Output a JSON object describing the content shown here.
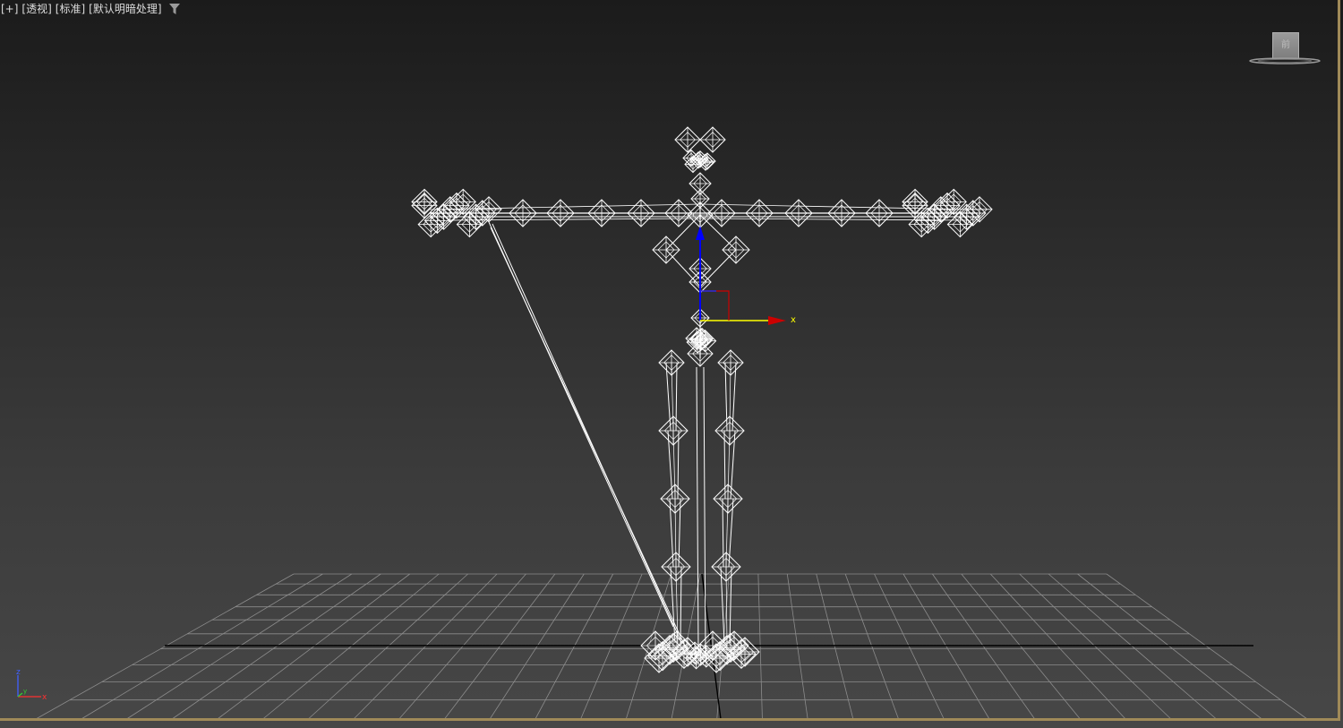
{
  "viewport": {
    "label_items": [
      "[+]",
      "[透视]",
      "[标准]",
      "[默认明暗处理]"
    ],
    "filter_icon": "filter-funnel-icon",
    "background_top": "#1b1b1b",
    "background_bottom": "#474747",
    "active_border_color": "#a08a58",
    "grid_color": "#8c8c8c",
    "grid_axis_color": "#000000",
    "wireframe_color": "#ffffff"
  },
  "viewcube": {
    "face_label": "前"
  },
  "gizmo": {
    "x_label": "x",
    "x_color": "#ffff00",
    "x_arrow_color": "#cc0000",
    "z_color": "#0000ff"
  },
  "axis_tripod": {
    "x_label": "x",
    "y_label": "y",
    "z_label": "z",
    "x_color": "#ff3030",
    "y_color": "#30d030",
    "z_color": "#4060ff"
  }
}
